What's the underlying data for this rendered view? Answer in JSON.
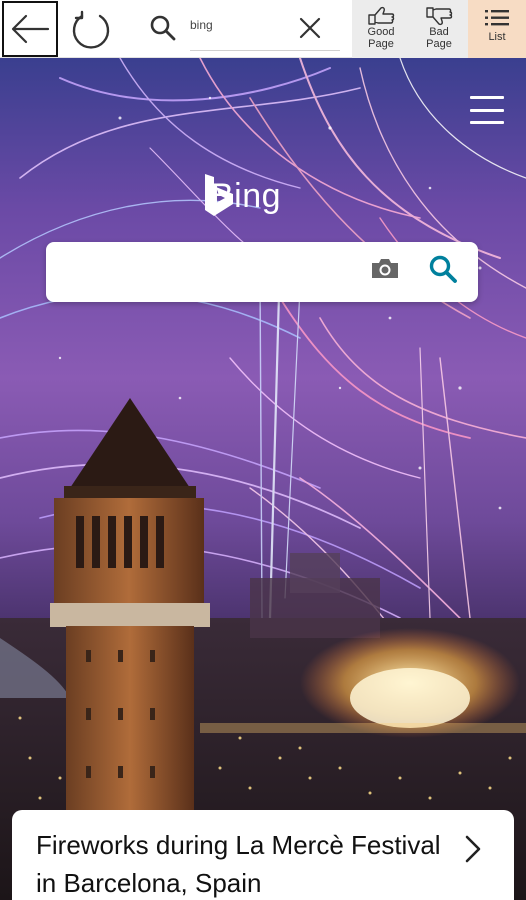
{
  "toolbar": {
    "back_icon": "arrow-left-icon",
    "reload_icon": "reload-icon",
    "search_icon": "search-icon",
    "url_value": "bing",
    "clear_icon": "close-icon",
    "good_page": {
      "icon": "thumbs-up-icon",
      "label_line1": "Good",
      "label_line2": "Page"
    },
    "bad_page": {
      "icon": "thumbs-down-icon",
      "label_line1": "Bad",
      "label_line2": "Page"
    },
    "list": {
      "icon": "list-icon",
      "label": "List"
    },
    "list_bg": "#f7dcc4"
  },
  "page": {
    "menu_icon": "hamburger-menu-icon",
    "logo_text": "Bing",
    "search": {
      "value": "",
      "camera_icon": "camera-icon",
      "search_icon": "search-icon"
    },
    "caption": {
      "text": "Fireworks during La Mercè Festival in Barcelona, Spain",
      "arrow_icon": "chevron-right-icon"
    }
  },
  "colors": {
    "accent": "#00809d"
  }
}
